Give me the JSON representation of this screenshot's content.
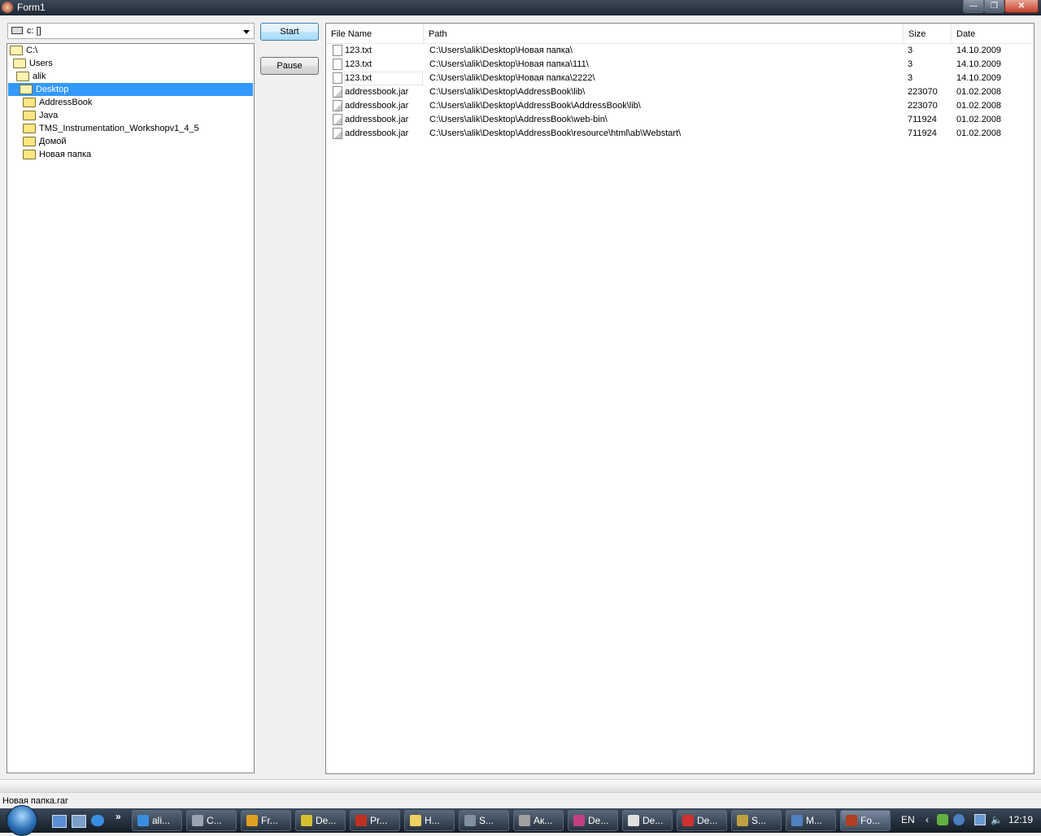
{
  "window": {
    "title": "Form1",
    "minimize": "—",
    "maximize": "❐",
    "close": "✕"
  },
  "drive": {
    "value": "c: []"
  },
  "tree": [
    {
      "label": "C:\\",
      "selected": false
    },
    {
      "label": "Users",
      "selected": false
    },
    {
      "label": "alik",
      "selected": false
    },
    {
      "label": "Desktop",
      "selected": true
    },
    {
      "label": "AddressBook",
      "selected": false
    },
    {
      "label": "Java",
      "selected": false
    },
    {
      "label": "TMS_Instrumentation_Workshopv1_4_5",
      "selected": false
    },
    {
      "label": "Домой",
      "selected": false
    },
    {
      "label": "Новая папка",
      "selected": false
    }
  ],
  "buttons": {
    "start": "Start",
    "pause": "Pause"
  },
  "list": {
    "columns": [
      "File Name",
      "Path",
      "Size",
      "Date"
    ],
    "rows": [
      {
        "icon": "text-file-icon",
        "name": "123.txt",
        "path": "C:\\Users\\alik\\Desktop\\Новая папка\\",
        "size": "3",
        "date": "14.10.2009"
      },
      {
        "icon": "text-file-icon",
        "name": "123.txt",
        "path": "C:\\Users\\alik\\Desktop\\Новая папка\\111\\",
        "size": "3",
        "date": "14.10.2009"
      },
      {
        "icon": "text-file-icon",
        "name": "123.txt",
        "path": "C:\\Users\\alik\\Desktop\\Новая папка\\2222\\",
        "size": "3",
        "date": "14.10.2009"
      },
      {
        "icon": "jar-file-icon",
        "name": "addressbook.jar",
        "path": "C:\\Users\\alik\\Desktop\\AddressBook\\lib\\",
        "size": "223070",
        "date": "01.02.2008"
      },
      {
        "icon": "jar-file-icon",
        "name": "addressbook.jar",
        "path": "C:\\Users\\alik\\Desktop\\AddressBook\\AddressBook\\lib\\",
        "size": "223070",
        "date": "01.02.2008"
      },
      {
        "icon": "jar-file-icon",
        "name": "addressbook.jar",
        "path": "C:\\Users\\alik\\Desktop\\AddressBook\\web-bin\\",
        "size": "711924",
        "date": "01.02.2008"
      },
      {
        "icon": "jar-file-icon",
        "name": "addressbook.jar",
        "path": "C:\\Users\\alik\\Desktop\\AddressBook\\resource\\html\\ab\\Webstart\\",
        "size": "711924",
        "date": "01.02.2008"
      }
    ]
  },
  "status": {
    "text": "Новая папка.rar"
  },
  "taskbar": {
    "overflow": "»",
    "items": [
      {
        "label": "ali...",
        "color": "#3a8ee0",
        "active": false
      },
      {
        "label": "C...",
        "color": "#9aa4b0",
        "active": false
      },
      {
        "label": "Fr...",
        "color": "#e0a020",
        "active": false
      },
      {
        "label": "De...",
        "color": "#d6c030",
        "active": false
      },
      {
        "label": "Pr...",
        "color": "#c03020",
        "active": false
      },
      {
        "label": "H...",
        "color": "#f0d060",
        "active": false
      },
      {
        "label": "S...",
        "color": "#8090a0",
        "active": false
      },
      {
        "label": "Ак...",
        "color": "#a0a0a0",
        "active": false
      },
      {
        "label": "De...",
        "color": "#c04080",
        "active": false
      },
      {
        "label": "De...",
        "color": "#e0e0e0",
        "active": false
      },
      {
        "label": "De...",
        "color": "#d03030",
        "active": false
      },
      {
        "label": "S...",
        "color": "#c0a040",
        "active": false
      },
      {
        "label": "M...",
        "color": "#5080c0",
        "active": false
      },
      {
        "label": "Fo...",
        "color": "#b04020",
        "active": true
      }
    ],
    "language": "EN",
    "time": "12:19"
  }
}
